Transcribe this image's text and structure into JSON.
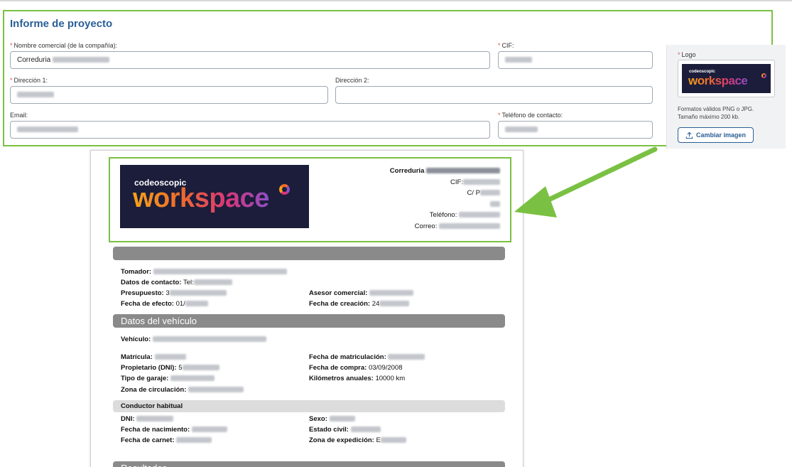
{
  "form": {
    "title": "Informe de proyecto",
    "fields": {
      "nombre": {
        "label": "Nombre comercial (de la compañía):",
        "value": "Correduria"
      },
      "cif": {
        "label": "CIF:"
      },
      "direccion1": {
        "label": "Dirección 1:"
      },
      "direccion2": {
        "label": "Dirección 2:"
      },
      "email": {
        "label": "Email:"
      },
      "telefono": {
        "label": "Teléfono de contacto:"
      }
    },
    "required_mark": "*",
    "logo": {
      "label": "Logo",
      "help_line1": "Formatos válidos PNG o JPG.",
      "help_line2": "Tamaño máximo 200 kb.",
      "button_label": "Cambiar imagen",
      "button_icon": "upload-icon"
    }
  },
  "brand": {
    "small_text": "codeoscopic",
    "big_text": "workspace",
    "bg_color": "#1b1d3a"
  },
  "report": {
    "company": {
      "name": "Correduria",
      "cif_label": "CIF:",
      "address_prefix": "C/ P",
      "phone_label": "Teléfono:",
      "email_label": "Correo:"
    },
    "policy": {
      "tomador_label": "Tomador:",
      "contacto_label": "Datos de contacto:",
      "contacto_value": "Tel:",
      "presupuesto_label": "Presupuesto:",
      "presupuesto_value": "3",
      "asesor_label": "Asesor comercial:",
      "efecto_label": "Fecha de efecto:",
      "efecto_value": "01/",
      "creacion_label": "Fecha de creación:",
      "creacion_value": "24"
    },
    "vehicle_section": {
      "title": "Datos del vehículo",
      "vehiculo_label": "Vehículo:",
      "matricula_label": "Matrícula:",
      "fecha_matriculacion_label": "Fecha de matriculación:",
      "propietario_label": "Propietario (DNI):",
      "propietario_value": "5",
      "fecha_compra_label": "Fecha de compra:",
      "fecha_compra_value": "03/09/2008",
      "garaje_label": "Tipo de garaje:",
      "km_label": "Kilómetros anuales:",
      "km_value": "10000 km",
      "zona_label": "Zona de circulación:"
    },
    "driver_section": {
      "title": "Conductor habitual",
      "dni_label": "DNI:",
      "sexo_label": "Sexo:",
      "nacimiento_label": "Fecha de nacimiento:",
      "estado_label": "Estado civil:",
      "carnet_label": "Fecha de carnet:",
      "expedicion_label": "Zona de expedición:",
      "expedicion_value": "E"
    },
    "results_section": {
      "title": "Resultados"
    }
  },
  "colors": {
    "accent_green": "#7ac143",
    "title_blue": "#2b5f96",
    "required_red": "#d9534f",
    "section_gray": "#8a8a8a"
  }
}
